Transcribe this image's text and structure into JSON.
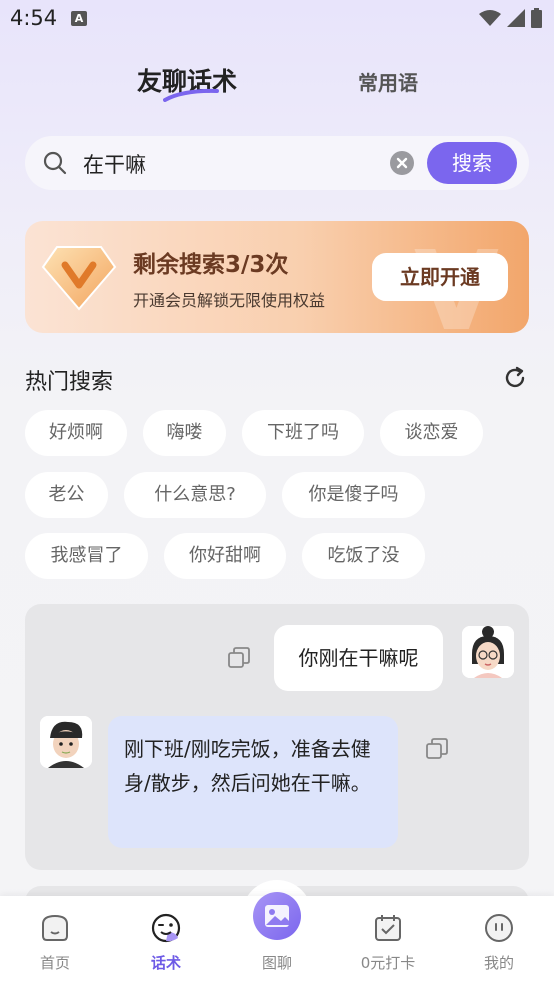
{
  "status": {
    "time": "4:54"
  },
  "tabs": {
    "main": "友聊话术",
    "sub": "常用语"
  },
  "search": {
    "value": "在干嘛",
    "button": "搜索"
  },
  "banner": {
    "title": "剩余搜索3/3次",
    "subtitle": "开通会员解锁无限使用权益",
    "button": "立即开通"
  },
  "hot": {
    "title": "热门搜索",
    "chips": [
      "好烦啊",
      "嗨喽",
      "下班了吗",
      "谈恋爱",
      "老公",
      "什么意思?",
      "你是傻子吗",
      "我感冒了",
      "你好甜啊",
      "吃饭了没"
    ]
  },
  "chat": {
    "question": "你刚在干嘛呢",
    "answer": "刚下班/刚吃完饭，准备去健身/散步，然后问她在干嘛。"
  },
  "nav": {
    "home": "首页",
    "scripts": "话术",
    "image": "图聊",
    "checkin": "0元打卡",
    "mine": "我的"
  },
  "colors": {
    "accent": "#7b66ee",
    "banner_text": "#6b3a22"
  }
}
